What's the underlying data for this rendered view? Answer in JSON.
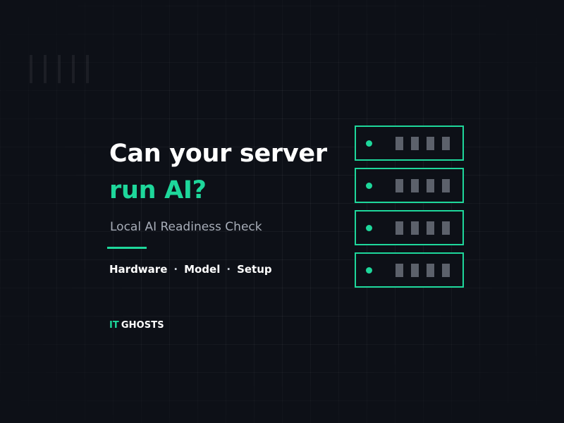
{
  "headline": {
    "line1": "Can your server",
    "line2": "run AI?"
  },
  "subtitle": "Local AI Readiness Check",
  "tags": [
    "Hardware",
    "Model",
    "Setup"
  ],
  "separator": "·",
  "brand": {
    "prefix": "IT",
    "name": "GHOSTS"
  },
  "rack": {
    "unit_count": 4,
    "bays_per_unit": 4
  },
  "colors": {
    "background": "#0d1017",
    "accent": "#1ed79b",
    "text": "#ffffff",
    "muted": "#a7adb8",
    "bay": "#5c616b"
  },
  "icons": [
    "server-rack-icon",
    "status-led-icon",
    "drive-bay-icon"
  ]
}
